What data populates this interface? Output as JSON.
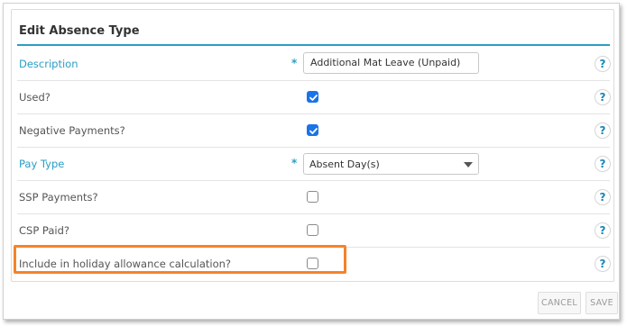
{
  "form": {
    "title": "Edit Absence Type",
    "required_mark": "*",
    "help_icon_text": "?",
    "description": {
      "label": "Description",
      "value": "Additional Mat Leave (Unpaid)",
      "required": true
    },
    "used": {
      "label": "Used?",
      "checked": true
    },
    "negative_payments": {
      "label": "Negative Payments?",
      "checked": true
    },
    "pay_type": {
      "label": "Pay Type",
      "value": "Absent Day(s)",
      "required": true
    },
    "ssp_payments": {
      "label": "SSP Payments?",
      "checked": false
    },
    "csp_paid": {
      "label": "CSP Paid?",
      "checked": false
    },
    "holiday_allowance": {
      "label": "Include in holiday allowance calculation?",
      "checked": false
    }
  },
  "buttons": {
    "cancel_label": "CANCEL",
    "save_label": "SAVE"
  },
  "colors": {
    "accent": "#2a9fc4",
    "checkbox_checked": "#1a73e8",
    "highlight": "#f5832a"
  }
}
